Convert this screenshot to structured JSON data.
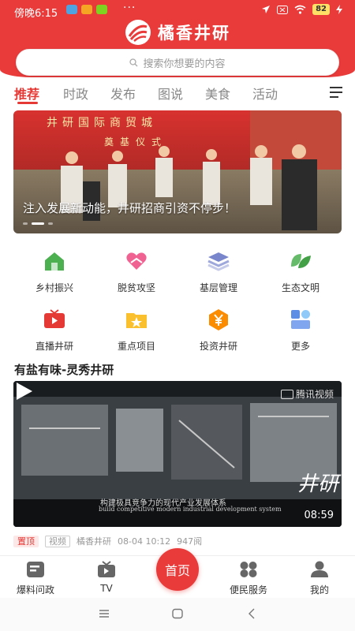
{
  "status_bar": {
    "time": "傍晚6:15",
    "battery": "82",
    "app_icon_colors": [
      "#4fa3e0",
      "#f5a623",
      "#7ed321"
    ]
  },
  "header": {
    "app_name": "橘香井研",
    "search_placeholder": "搜索你想要的内容",
    "accent_color": "#ea3b3b"
  },
  "tabs": [
    {
      "label": "推荐",
      "active": true
    },
    {
      "label": "时政",
      "active": false
    },
    {
      "label": "发布",
      "active": false
    },
    {
      "label": "图说",
      "active": false
    },
    {
      "label": "美食",
      "active": false
    },
    {
      "label": "活动",
      "active": false
    }
  ],
  "banner": {
    "caption": "注入发展新动能，井研招商引资不停步！",
    "sign_text": "井研国际商贸城",
    "sign_text2": "奠基仪式",
    "slides": 3,
    "active_slide": 1
  },
  "grid": [
    {
      "label": "乡村振兴",
      "icon": "house-icon",
      "color": "#4caf50"
    },
    {
      "label": "脱贫攻坚",
      "icon": "heart-hands-icon",
      "color": "#f06292"
    },
    {
      "label": "基层管理",
      "icon": "layers-icon",
      "color": "#7986cb"
    },
    {
      "label": "生态文明",
      "icon": "leaves-icon",
      "color": "#43a047"
    },
    {
      "label": "直播井研",
      "icon": "tv-icon",
      "color": "#e53935"
    },
    {
      "label": "重点项目",
      "icon": "star-folder-icon",
      "color": "#fbc02d"
    },
    {
      "label": "投资井研",
      "icon": "yuan-icon",
      "color": "#fb8c00"
    },
    {
      "label": "更多",
      "icon": "more-icon",
      "color": "#5c8ee6"
    }
  ],
  "section": {
    "title": "有盐有味-灵秀井研",
    "video": {
      "watermark": "腾讯视频",
      "subtitle_cn": "构建极具竞争力的现代产业发展体系",
      "subtitle_en": "build competitive modern industrial development system",
      "duration": "08:59",
      "seal_text": "井研"
    },
    "meta": {
      "tag_top": "置顶",
      "tag_video": "视频",
      "source": "橘香井研",
      "datetime": "08-04 10:12",
      "views": "947阅"
    }
  },
  "bottom_nav": [
    {
      "label": "爆料问政",
      "icon": "report-icon"
    },
    {
      "label": "TV",
      "icon": "tv-icon"
    },
    {
      "label": "首页",
      "icon": "home-icon"
    },
    {
      "label": "便民服务",
      "icon": "grid-icon"
    },
    {
      "label": "我的",
      "icon": "user-icon"
    }
  ]
}
